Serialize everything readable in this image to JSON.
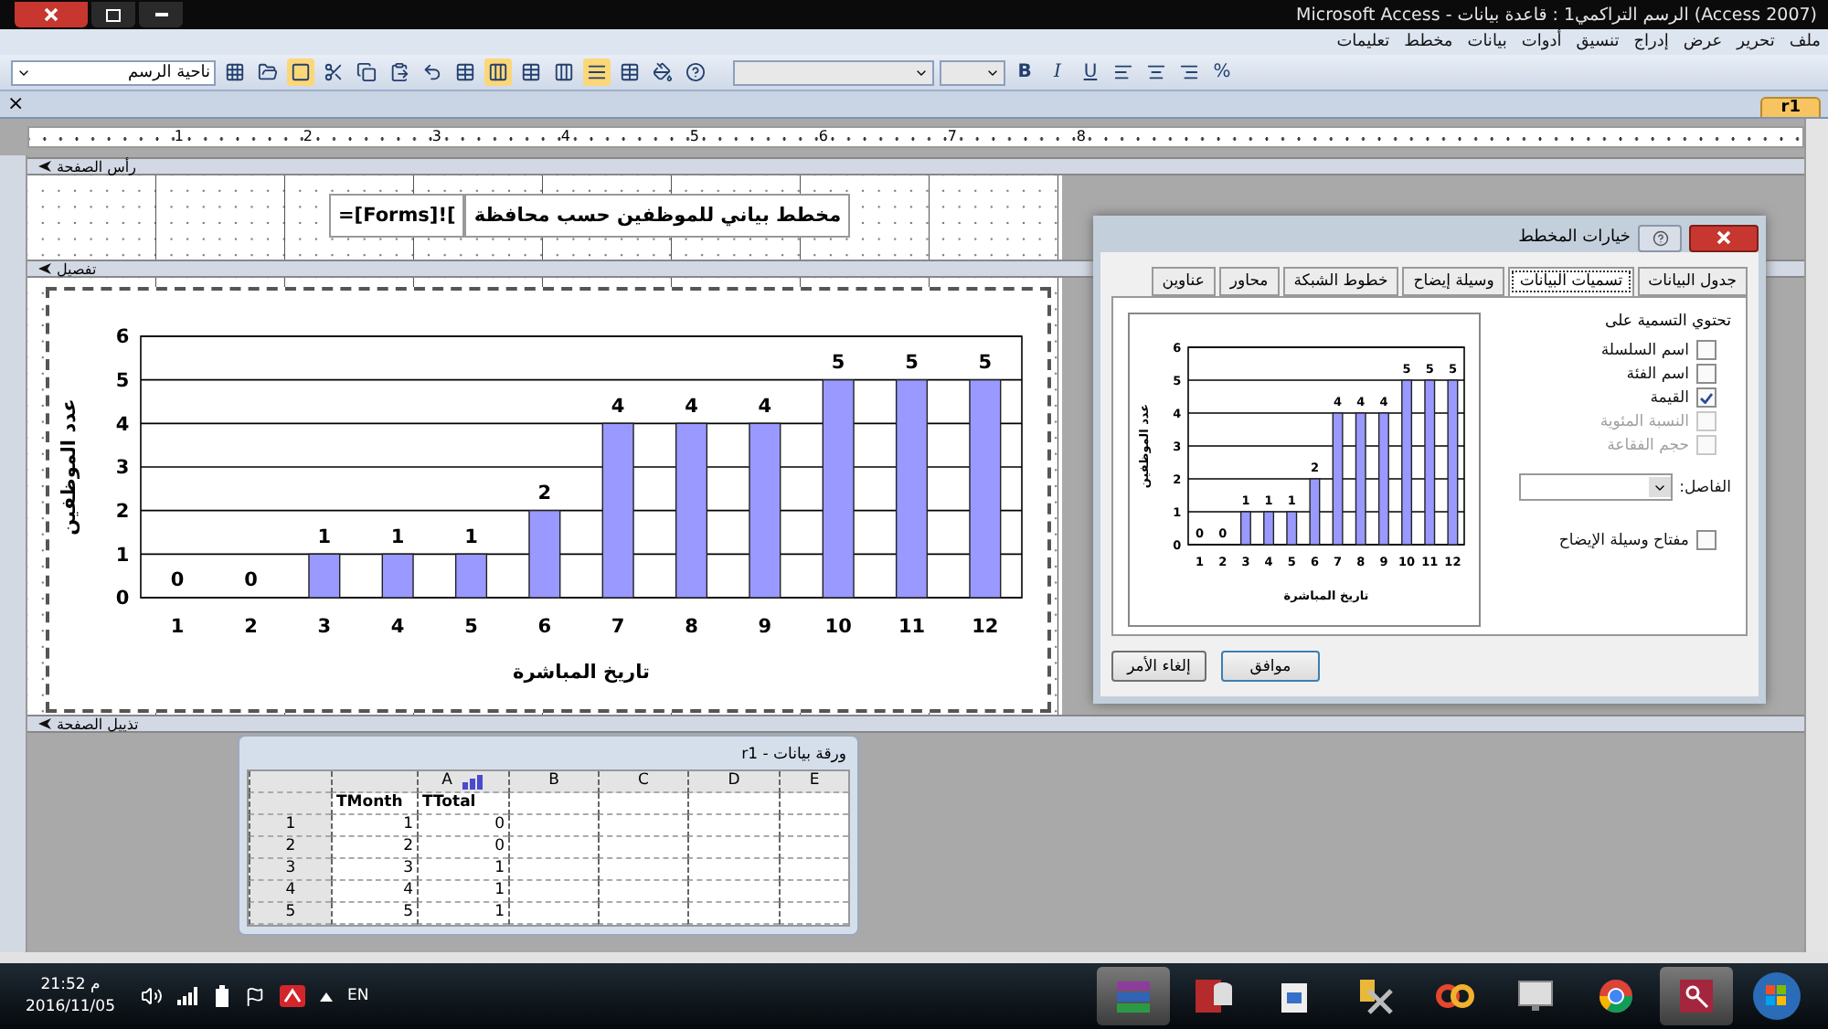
{
  "window": {
    "title": "Microsoft Access - الرسم التراكمي1 : قاعدة بيانات (Access 2007)"
  },
  "menu": [
    {
      "label": "ملف"
    },
    {
      "label": "تحرير"
    },
    {
      "label": "عرض"
    },
    {
      "label": "إدراج"
    },
    {
      "label": "تنسيق"
    },
    {
      "label": "أدوات"
    },
    {
      "label": "بيانات"
    },
    {
      "label": "مخطط"
    },
    {
      "label": "تعليمات"
    }
  ],
  "toolbar": {
    "object_select": "ناحية الرسم",
    "format_buttons": [
      {
        "label": "U",
        "kind": "underline"
      },
      {
        "label": "I",
        "kind": "italic"
      },
      {
        "label": "B",
        "kind": "bold"
      }
    ],
    "number_buttons": [
      "%"
    ]
  },
  "document_strip": {
    "close": "×",
    "tab": "r1"
  },
  "ruler": {
    "marks": [
      "8",
      "7",
      "6",
      "5",
      "4",
      "3",
      "2",
      "1"
    ]
  },
  "sections": [
    {
      "label": "رأس الصفحة"
    },
    {
      "label": "تفصيل"
    },
    {
      "label": "تذييل الصفحة"
    }
  ],
  "header_controls": {
    "title": "مخطط بياني للموظفين حسب محافظة",
    "expression": "=[Forms]!["
  },
  "chart": {
    "chart_data": {
      "type": "bar",
      "xlabel": "تاريخ المباشرة",
      "ylabel": "عدد الموظفين",
      "categories": [
        "1",
        "2",
        "3",
        "4",
        "5",
        "6",
        "7",
        "8",
        "9",
        "10",
        "11",
        "12"
      ],
      "values": [
        0,
        0,
        1,
        1,
        1,
        2,
        4,
        4,
        4,
        5,
        5,
        5
      ],
      "ylim": [
        0,
        6
      ],
      "yticks": [
        0,
        1,
        2,
        3,
        4,
        5,
        6
      ],
      "grid": true,
      "data_labels": true
    }
  },
  "dialog": {
    "title": "خيارات المخطط",
    "tabs": [
      {
        "label": "جدول البيانات",
        "selected": false
      },
      {
        "label": "تسميات البيانات",
        "selected": true
      },
      {
        "label": "وسيلة إيضاح",
        "selected": false
      },
      {
        "label": "خطوط الشبكة",
        "selected": false
      },
      {
        "label": "محاور",
        "selected": false
      },
      {
        "label": "عناوين",
        "selected": false
      }
    ],
    "group_label": "تحتوي التسمية على",
    "options": [
      {
        "label": "اسم السلسلة",
        "checked": false,
        "disabled": false
      },
      {
        "label": "اسم الفئة",
        "checked": false,
        "disabled": false
      },
      {
        "label": "القيمة",
        "checked": true,
        "disabled": false
      },
      {
        "label": "النسبة المئوية",
        "checked": false,
        "disabled": true
      },
      {
        "label": "حجم الفقاعة",
        "checked": false,
        "disabled": true
      }
    ],
    "separator_label": "الفاصل:",
    "legend_key": {
      "label": "مفتاح وسيلة الإيضاح",
      "checked": false
    },
    "preview": {
      "chart_data": {
        "type": "bar",
        "xlabel": "تاريخ المباشرة",
        "ylabel": "عدد الموظفين",
        "categories": [
          "1",
          "2",
          "3",
          "4",
          "5",
          "6",
          "7",
          "8",
          "9",
          "10",
          "11",
          "12"
        ],
        "values": [
          0,
          0,
          1,
          1,
          1,
          2,
          4,
          4,
          4,
          5,
          5,
          5
        ],
        "ylim": [
          0,
          6
        ],
        "yticks": [
          0,
          1,
          2,
          3,
          4,
          5,
          6
        ],
        "grid": true,
        "data_labels": true
      }
    },
    "buttons": [
      {
        "label": "موافق",
        "default": true
      },
      {
        "label": "إلغاء الأمر",
        "default": false
      }
    ]
  },
  "datasheet": {
    "title": "ورقة بيانات - r1",
    "columns": [
      "E",
      "D",
      "C",
      "B",
      "A"
    ],
    "field_names": [
      "TTotal",
      "TMonth"
    ],
    "rows": [
      {
        "label": "1",
        "cells": [
          "0",
          "1"
        ]
      },
      {
        "label": "2",
        "cells": [
          "0",
          "2"
        ]
      },
      {
        "label": "3",
        "cells": [
          "1",
          "3"
        ]
      },
      {
        "label": "4",
        "cells": [
          "1",
          "4"
        ]
      },
      {
        "label": "5",
        "cells": [
          "1",
          "5"
        ]
      }
    ]
  },
  "taskbar": {
    "time": "21:52 م",
    "date": "2016/11/05",
    "language": "EN"
  }
}
